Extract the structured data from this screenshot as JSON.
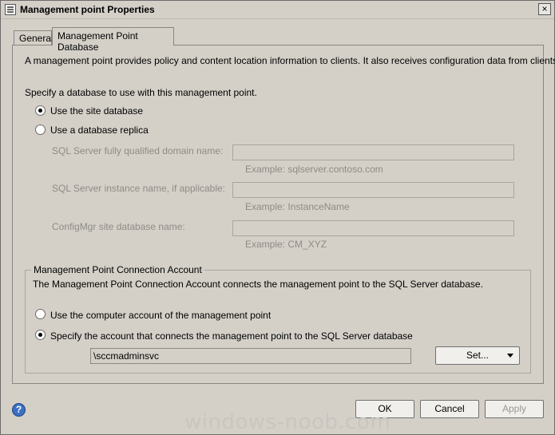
{
  "window": {
    "title": "Management point Properties",
    "close_label": "×"
  },
  "tabs": [
    {
      "label": "General"
    },
    {
      "label": "Management Point Database"
    }
  ],
  "panel": {
    "description": "A management point provides policy and content location information to clients.  It also receives configuration data from clients.",
    "specify_label": "Specify a database to use with this management point.",
    "radio_site_db": "Use the site database",
    "radio_replica": "Use a database replica",
    "sql_fqdn_label": "SQL Server fully qualified domain name:",
    "sql_fqdn_value": "",
    "sql_fqdn_example": "Example: sqlserver.contoso.com",
    "sql_instance_label": "SQL Server instance name, if applicable:",
    "sql_instance_value": "",
    "sql_instance_example": "Example: InstanceName",
    "site_db_label": "ConfigMgr site database name:",
    "site_db_value": "",
    "site_db_example": "Example: CM_XYZ"
  },
  "connection_account": {
    "group_title": "Management Point Connection Account",
    "description": "The Management Point Connection Account connects the management point to the SQL Server database.",
    "radio_computer": "Use the computer account of the management point",
    "radio_specify": "Specify the account that connects the management point to the SQL Server database",
    "account_value": "\\sccmadminsvc",
    "set_button": "Set..."
  },
  "footer": {
    "ok": "OK",
    "cancel": "Cancel",
    "apply": "Apply",
    "help_glyph": "?"
  },
  "watermark": "windows-noob.com"
}
